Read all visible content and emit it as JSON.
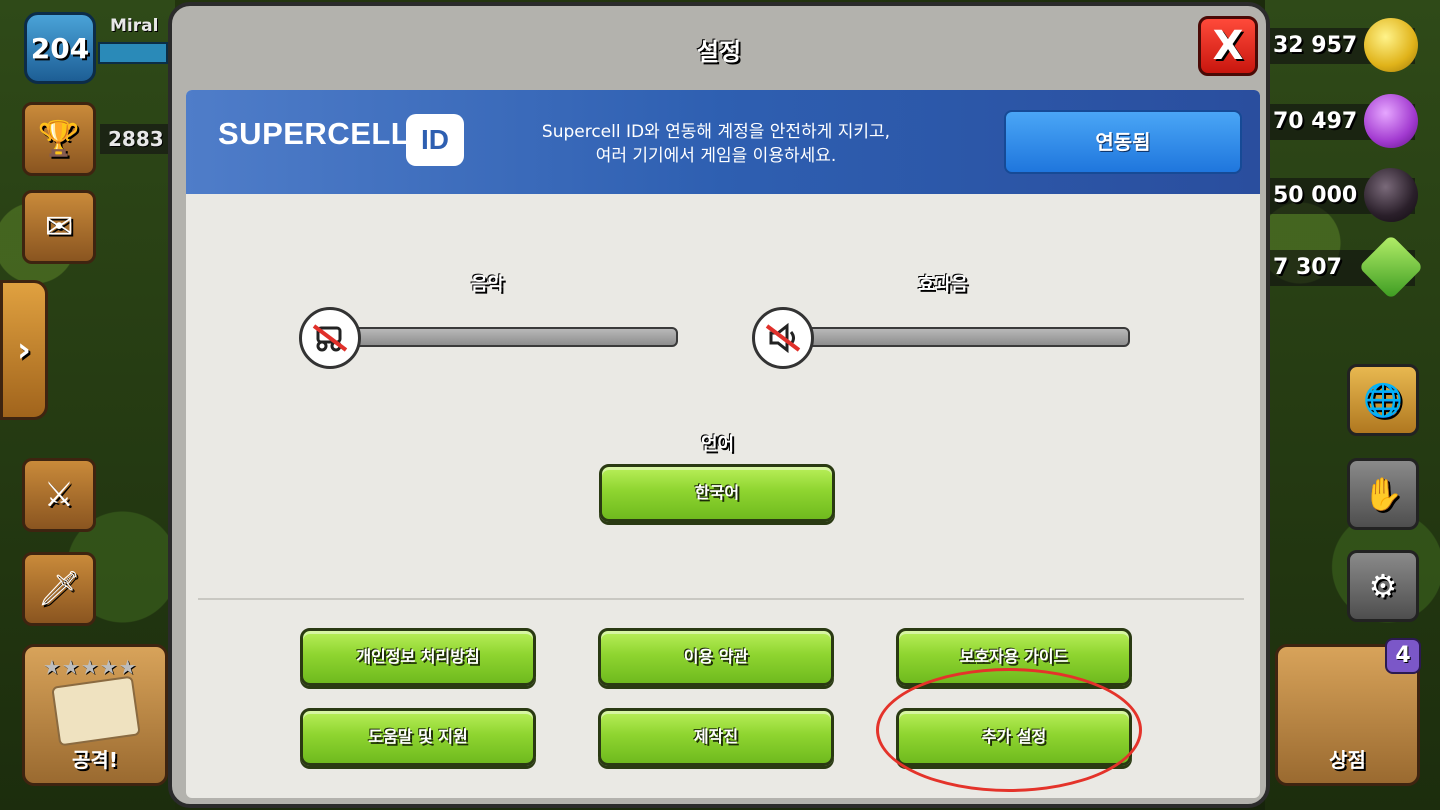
{
  "hud": {
    "level": "204",
    "player_name": "Miral",
    "trophies": "2883",
    "attack_label": "공격!",
    "shop_label": "상점",
    "shop_badge": "4",
    "gold": "32 957",
    "elixir": "70 497",
    "dark_elixir": "50 000",
    "gems": "7 307"
  },
  "modal": {
    "title": "설정",
    "close_label": "X",
    "supercell": {
      "logo_text": "SUPERCELL",
      "logo_id": "ID",
      "description_line1": "Supercell ID와 연동해 계정을 안전하게 지키고,",
      "description_line2": "여러 기기에서 게임을 이용하세요.",
      "button_label": "연동됨"
    },
    "music": {
      "label": "음악",
      "level": 0
    },
    "sfx": {
      "label": "효과음",
      "level": 0
    },
    "language": {
      "label": "언어",
      "value": "한국어"
    },
    "buttons": {
      "privacy": "개인정보 처리방침",
      "terms": "이용 약관",
      "parents": "보호자용 가이드",
      "help": "도움말 및 지원",
      "credits": "제작진",
      "more": "추가 설정"
    }
  },
  "colors": {
    "accent_green": "#8fd530",
    "banner_blue": "#2e5fb1",
    "close_red": "#e0241a",
    "highlight": "#e4332a"
  }
}
